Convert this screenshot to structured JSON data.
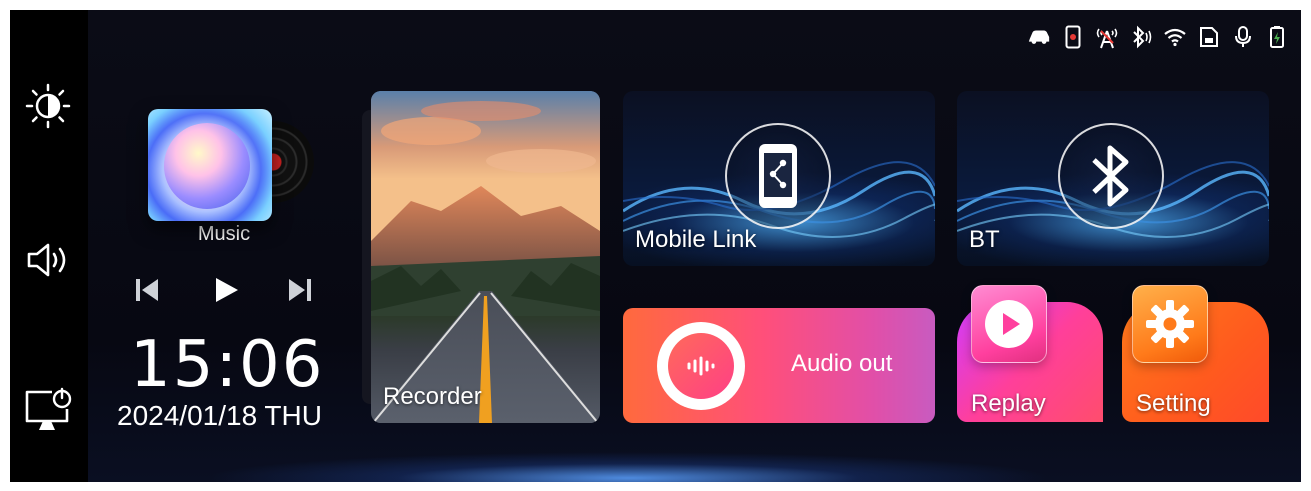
{
  "rail": {
    "items": [
      {
        "icon": "brightness-icon"
      },
      {
        "icon": "volume-icon"
      },
      {
        "icon": "screen-off-icon"
      }
    ]
  },
  "status_bar": {
    "icons": [
      "car-icon",
      "phone-link-icon",
      "signal-tower-icon",
      "bluetooth-status-icon",
      "wifi-icon",
      "sd-card-icon",
      "microphone-icon",
      "battery-charging-icon"
    ]
  },
  "music": {
    "label": "Music",
    "controls": [
      "previous-icon",
      "play-icon",
      "next-icon"
    ]
  },
  "clock": {
    "time": "15:06",
    "date": "2024/01/18 THU"
  },
  "tiles": {
    "recorder": {
      "label": "Recorder"
    },
    "mobile_link": {
      "label": "Mobile Link",
      "icon": "phone-share-icon"
    },
    "bt": {
      "label": "BT",
      "icon": "bluetooth-icon"
    },
    "audio_out": {
      "label": "Audio out",
      "icon": "audio-wave-icon"
    },
    "replay": {
      "label": "Replay",
      "icon": "play-circle-icon"
    },
    "setting": {
      "label": "Setting",
      "icon": "gear-icon"
    }
  },
  "colors": {
    "accent_blue": "#4aa8ff",
    "audio_gradient_start": "#ff6a3d",
    "audio_gradient_end": "#c85bc0",
    "replay_pink": "#ff3f9a",
    "setting_orange": "#ff7a1a"
  }
}
